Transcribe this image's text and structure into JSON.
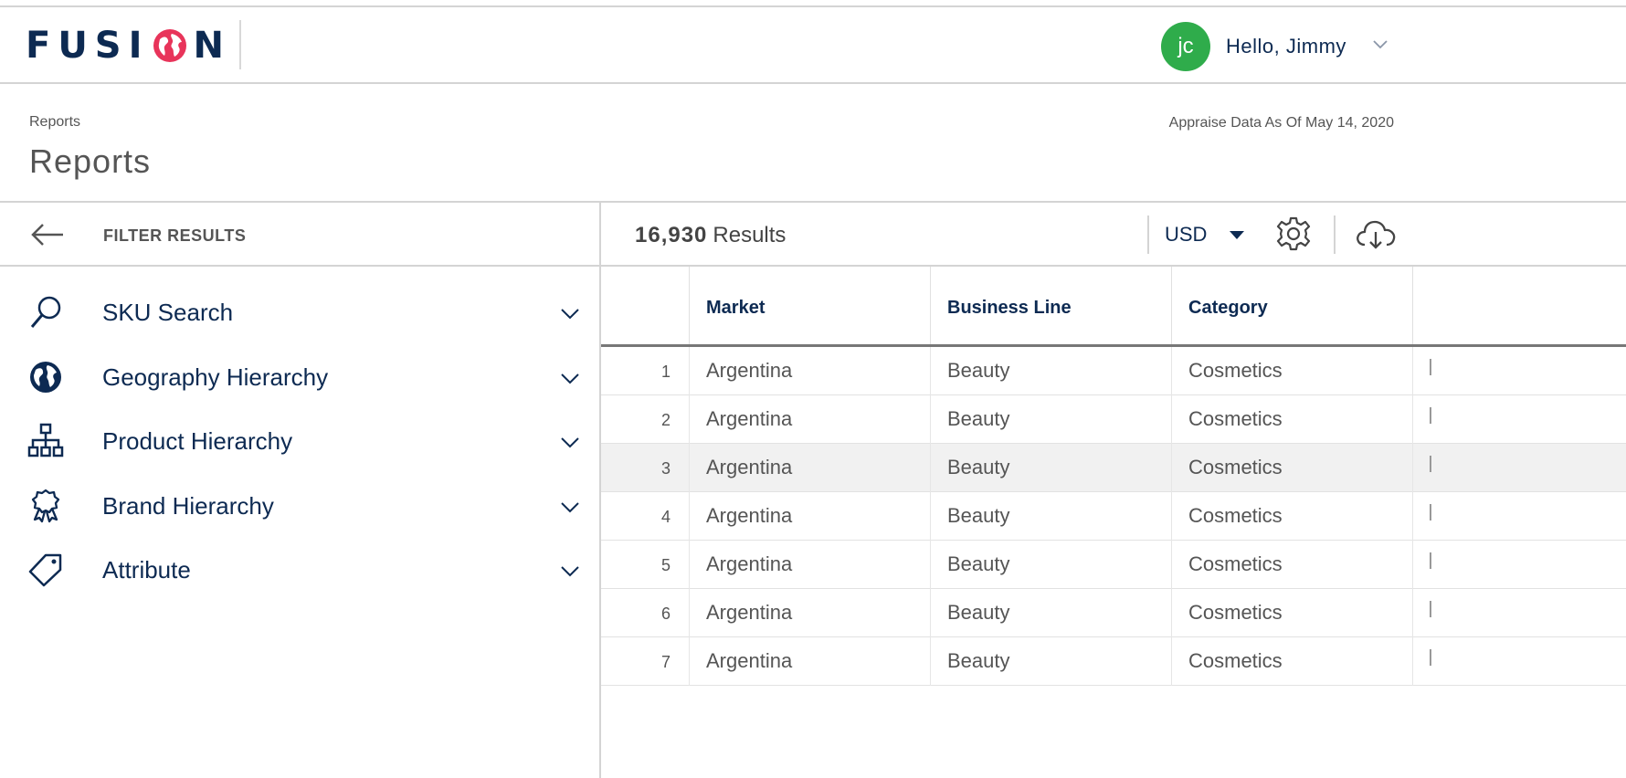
{
  "header": {
    "logo_text": "FUSION",
    "avatar_initials": "jc",
    "greeting": "Hello, Jimmy",
    "avatar_color": "#2fac4b",
    "brand_color": "#0d2a52",
    "logo_accent": "#e8345a"
  },
  "page": {
    "breadcrumb": "Reports",
    "title": "Reports",
    "appraise_text": "Appraise Data As Of May 14, 2020"
  },
  "filters": {
    "title": "FILTER RESULTS",
    "items": [
      {
        "label": "SKU Search",
        "icon": "search-icon"
      },
      {
        "label": "Geography Hierarchy",
        "icon": "globe-icon"
      },
      {
        "label": "Product Hierarchy",
        "icon": "hierarchy-icon"
      },
      {
        "label": "Brand Hierarchy",
        "icon": "award-icon"
      },
      {
        "label": "Attribute",
        "icon": "tag-icon"
      }
    ]
  },
  "results": {
    "count": "16,930",
    "label": "Results",
    "currency": "USD"
  },
  "table": {
    "columns": [
      "",
      "Market",
      "Business Line",
      "Category"
    ],
    "rows": [
      {
        "index": "1",
        "market": "Argentina",
        "business_line": "Beauty",
        "category": "Cosmetics"
      },
      {
        "index": "2",
        "market": "Argentina",
        "business_line": "Beauty",
        "category": "Cosmetics"
      },
      {
        "index": "3",
        "market": "Argentina",
        "business_line": "Beauty",
        "category": "Cosmetics"
      },
      {
        "index": "4",
        "market": "Argentina",
        "business_line": "Beauty",
        "category": "Cosmetics"
      },
      {
        "index": "5",
        "market": "Argentina",
        "business_line": "Beauty",
        "category": "Cosmetics"
      },
      {
        "index": "6",
        "market": "Argentina",
        "business_line": "Beauty",
        "category": "Cosmetics"
      },
      {
        "index": "7",
        "market": "Argentina",
        "business_line": "Beauty",
        "category": "Cosmetics"
      }
    ]
  }
}
